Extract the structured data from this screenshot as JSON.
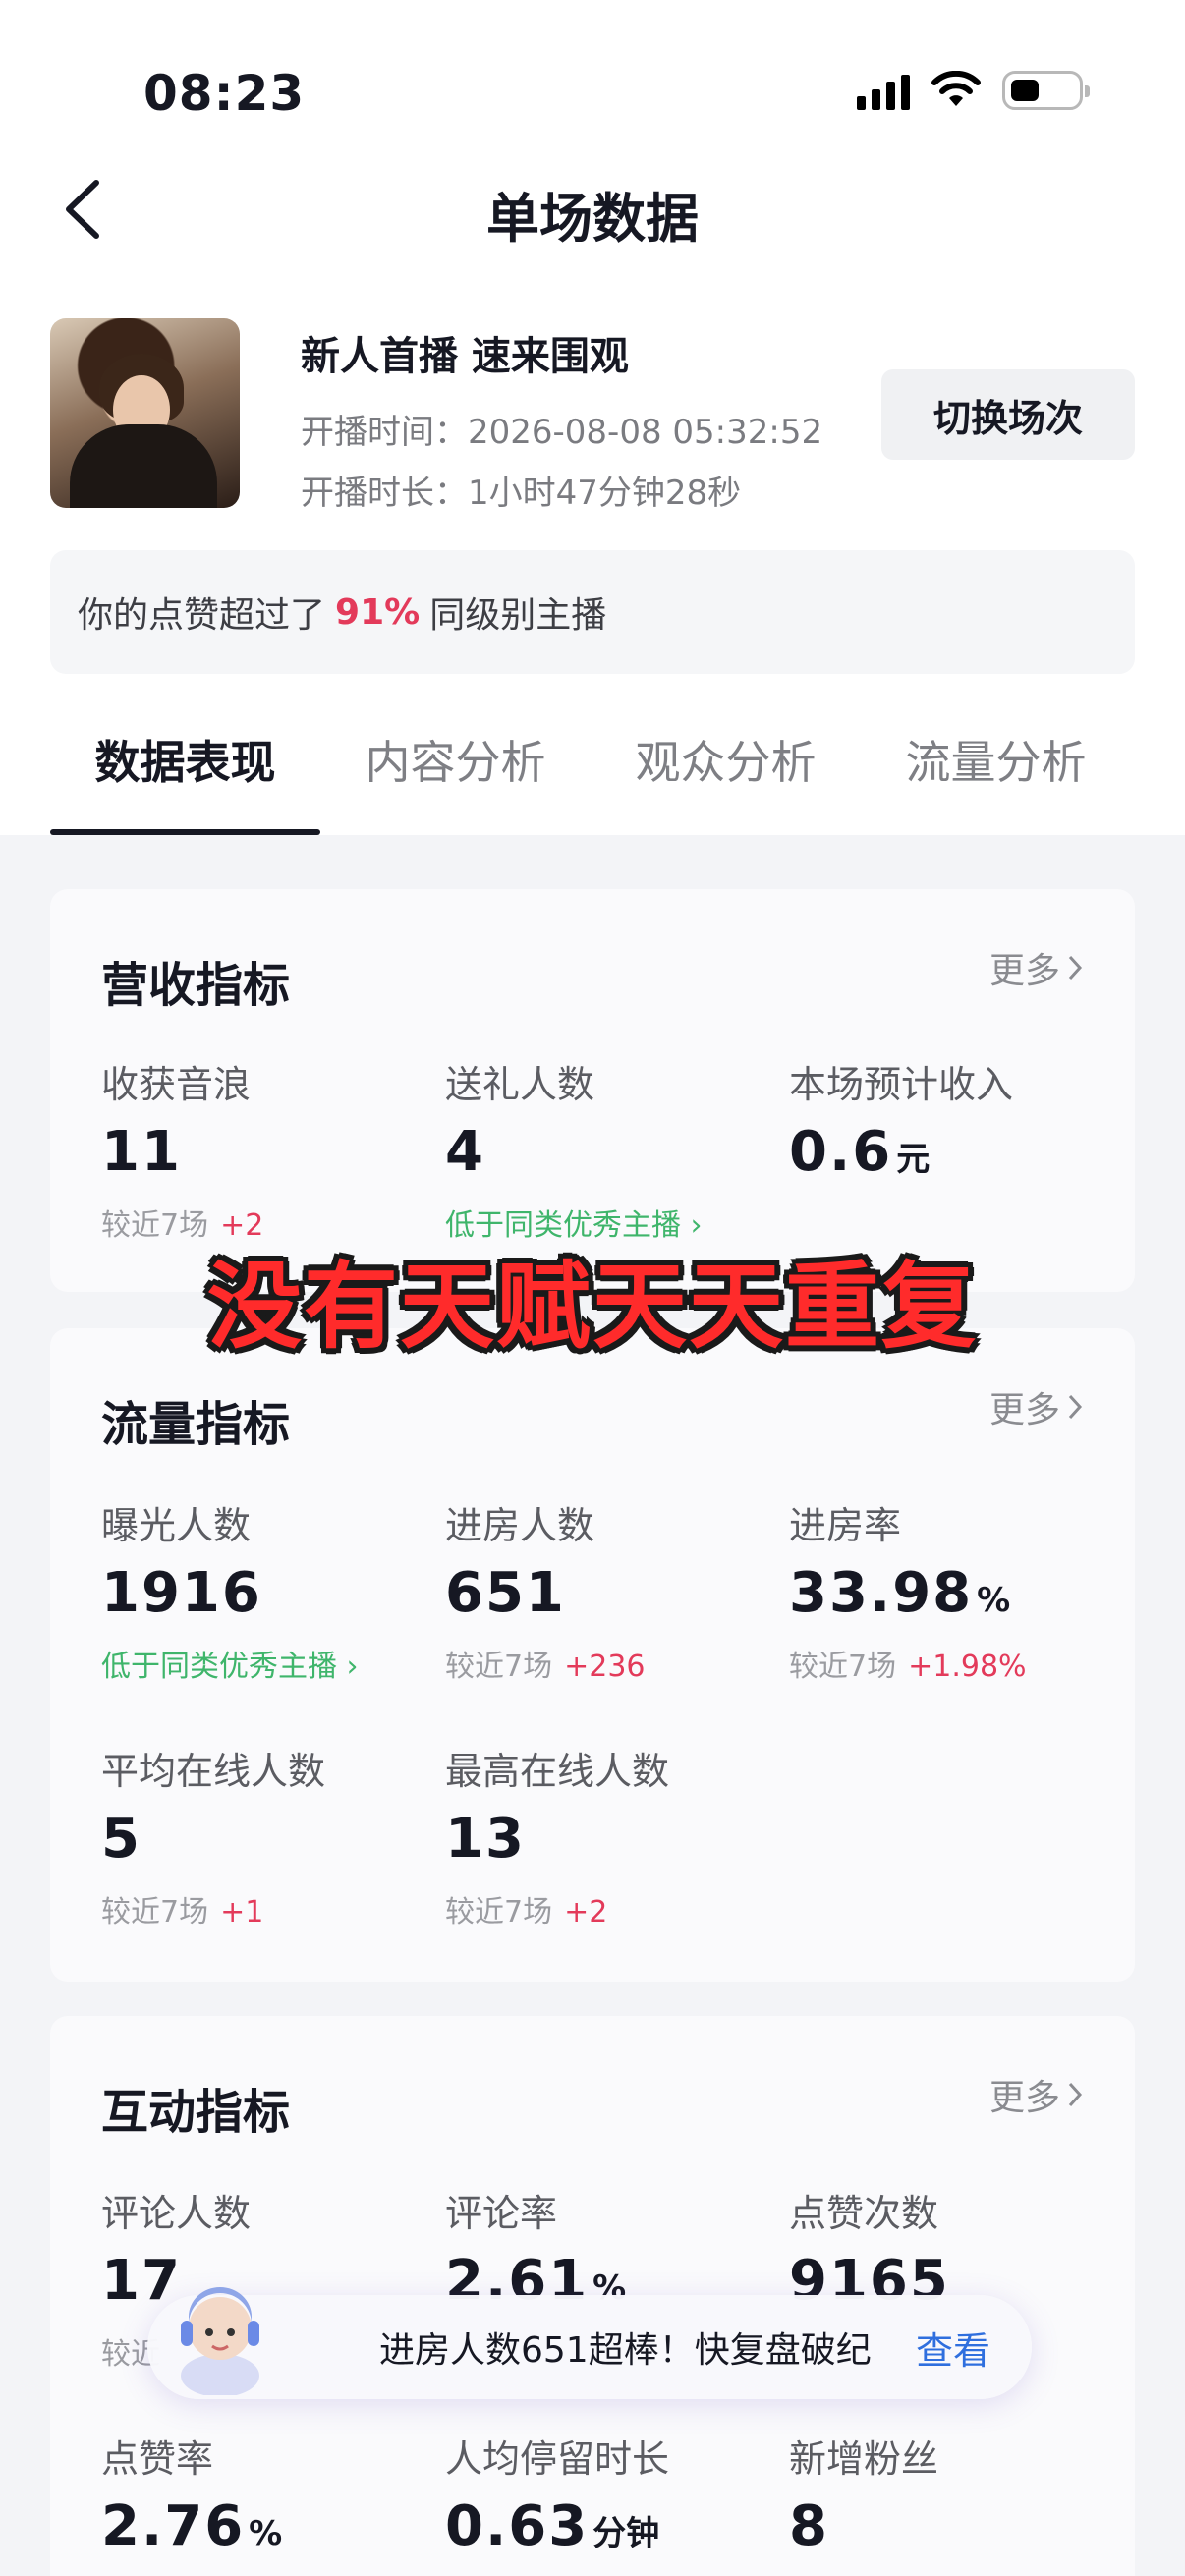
{
  "status_bar": {
    "time": "08:23"
  },
  "nav": {
    "title": "单场数据"
  },
  "live": {
    "title": "新人首播 速来围观",
    "start_time": "开播时间：2026-08-08 05:32:52",
    "duration": "开播时长：1小时47分钟28秒",
    "switch_label": "切换场次"
  },
  "like_banner": {
    "prefix": "你的点赞超过了",
    "percent": "91%",
    "suffix": "同级别主播"
  },
  "tabs": [
    {
      "label": "数据表现",
      "active": true
    },
    {
      "label": "内容分析"
    },
    {
      "label": "观众分析"
    },
    {
      "label": "流量分析"
    }
  ],
  "revenue": {
    "title": "营收指标",
    "more": "更多",
    "metrics": [
      {
        "label": "收获音浪",
        "value": "11",
        "unit": "",
        "sub": "较近7场",
        "delta": "+2"
      },
      {
        "label": "送礼人数",
        "value": "4",
        "unit": "",
        "sub_green": "低于同类优秀主播"
      },
      {
        "label": "本场预计收入",
        "value": "0.6",
        "unit": "元"
      }
    ]
  },
  "traffic": {
    "title": "流量指标",
    "more": "更多",
    "metrics": [
      {
        "label": "曝光人数",
        "value": "1916",
        "unit": "",
        "sub_green": "低于同类优秀主播"
      },
      {
        "label": "进房人数",
        "value": "651",
        "unit": "",
        "sub": "较近7场",
        "delta": "+236"
      },
      {
        "label": "进房率",
        "value": "33.98",
        "unit": "%",
        "sub": "较近7场",
        "delta": "+1.98%"
      },
      {
        "label": "平均在线人数",
        "value": "5",
        "unit": "",
        "sub": "较近7场",
        "delta": "+1"
      },
      {
        "label": "最高在线人数",
        "value": "13",
        "unit": "",
        "sub": "较近7场",
        "delta": "+2"
      }
    ]
  },
  "interaction": {
    "title": "互动指标",
    "more": "更多",
    "metrics": [
      {
        "label": "评论人数",
        "value": "17",
        "unit": "",
        "sub": "较近"
      },
      {
        "label": "评论率",
        "value": "2.61",
        "unit": "%"
      },
      {
        "label": "点赞次数",
        "value": "9165",
        "unit": ""
      },
      {
        "label": "点赞率",
        "value": "2.76",
        "unit": "%"
      },
      {
        "label": "人均停留时长",
        "value": "0.63",
        "unit": "分钟"
      },
      {
        "label": "新增粉丝",
        "value": "8",
        "unit": ""
      }
    ]
  },
  "overlay_caption": "没有天赋天天重复",
  "toast": {
    "text": "进房人数651超棒！快复盘破纪",
    "link": "查看"
  },
  "colors": {
    "accent_red": "#e33a5a",
    "good_green": "#3fb56b",
    "link_blue": "#2f6fde",
    "caption_red": "#ff2b2b"
  }
}
